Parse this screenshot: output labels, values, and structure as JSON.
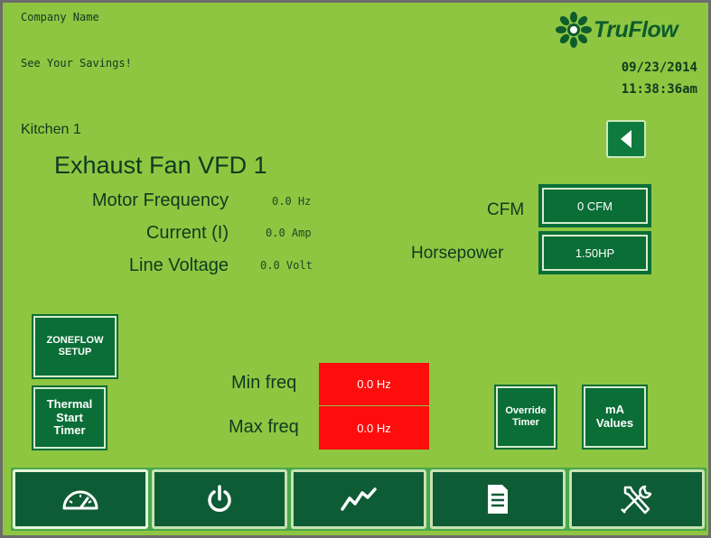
{
  "header": {
    "company_name": "Company Name",
    "tagline": "See Your Savings!",
    "logo_text": "TruFlow",
    "date": "09/23/2014",
    "time": "11:38:36am"
  },
  "location": {
    "zone": "Kitchen 1",
    "device_title": "Exhaust Fan VFD 1"
  },
  "readings": {
    "motor_frequency_label": "Motor Frequency",
    "motor_frequency_value": "0.0 Hz",
    "current_label": "Current (I)",
    "current_value": "0.0 Amp",
    "line_voltage_label": "Line Voltage",
    "line_voltage_value": "0.0 Volt"
  },
  "settings": {
    "cfm_label": "CFM",
    "cfm_value": "0 CFM",
    "horsepower_label": "Horsepower",
    "horsepower_value": "1.50HP",
    "min_freq_label": "Min freq",
    "min_freq_value": "0.0 Hz",
    "max_freq_label": "Max freq",
    "max_freq_value": "0.0 Hz"
  },
  "buttons": {
    "zoneflow_setup_line1": "ZONEFLOW",
    "zoneflow_setup_line2": "SETUP",
    "thermal_line1": "Thermal",
    "thermal_line2": "Start",
    "thermal_line3": "Timer",
    "override_line1": "Override",
    "override_line2": "Timer",
    "ma_line1": "mA",
    "ma_line2": "Values"
  },
  "nav": {
    "items": [
      "gauge-icon",
      "power-icon",
      "trend-icon",
      "document-icon",
      "tools-icon"
    ],
    "active": "gauge-icon"
  },
  "colors": {
    "background": "#8ec641",
    "button": "#0a6e36",
    "alarm": "#ff0d0d",
    "brand": "#0d5c2c"
  }
}
